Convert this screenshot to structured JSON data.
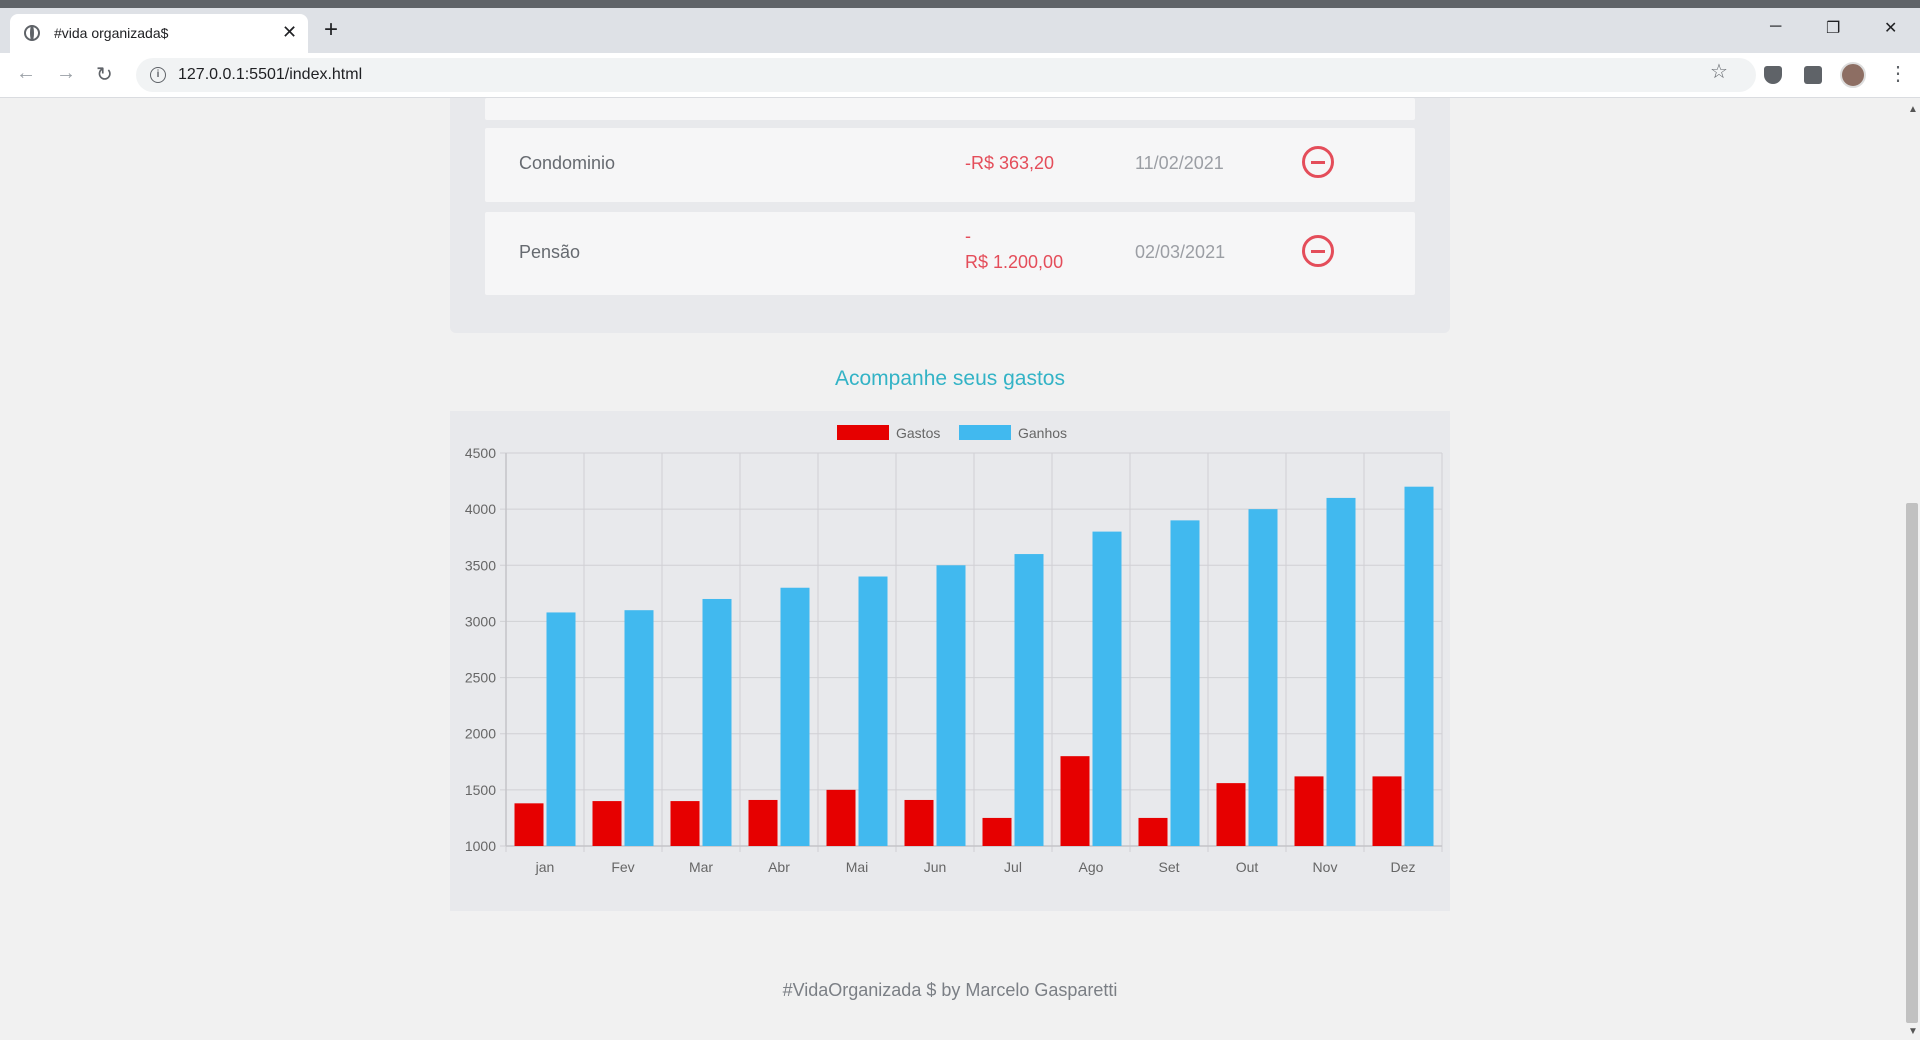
{
  "browser": {
    "tab_title": "#vida organizada$",
    "tab_close": "✕",
    "new_tab": "+",
    "url": "127.0.0.1:5501/index.html",
    "minimize": "─",
    "restore": "❐",
    "close": "✕"
  },
  "transactions": [
    {
      "name": "Condominio",
      "amount_sign": "",
      "amount": "-R$ 363,20",
      "date": "11/02/2021"
    },
    {
      "name": "Pensão",
      "amount_sign": "-",
      "amount": "R$ 1.200,00",
      "date": "02/03/2021"
    }
  ],
  "chart_section_title": "Acompanhe seus gastos",
  "chart_data": {
    "type": "bar",
    "categories": [
      "jan",
      "Fev",
      "Mar",
      "Abr",
      "Mai",
      "Jun",
      "Jul",
      "Ago",
      "Set",
      "Out",
      "Nov",
      "Dez"
    ],
    "series": [
      {
        "name": "Gastos",
        "color": "#e60000",
        "values": [
          1380,
          1400,
          1400,
          1410,
          1500,
          1410,
          1250,
          1800,
          1250,
          1560,
          1620,
          1620
        ]
      },
      {
        "name": "Ganhos",
        "color": "#41b9ef",
        "values": [
          3080,
          3100,
          3200,
          3300,
          3400,
          3500,
          3600,
          3800,
          3900,
          4000,
          4100,
          4200
        ]
      }
    ],
    "yticks": [
      1000,
      1500,
      2000,
      2500,
      3000,
      3500,
      4000,
      4500
    ],
    "ylim": [
      1000,
      4500
    ],
    "grid": true,
    "legend": "top"
  },
  "footer": "#VidaOrganizada $ by Marcelo Gasparetti"
}
